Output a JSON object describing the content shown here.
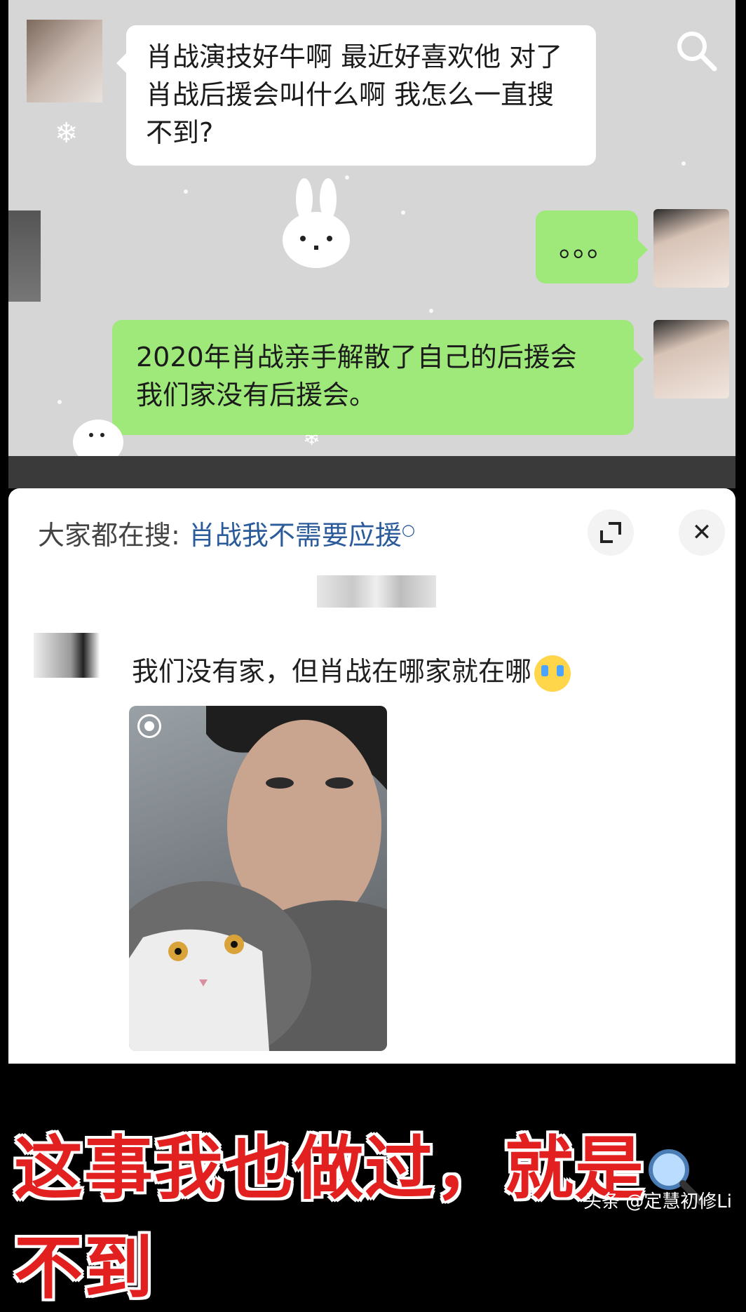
{
  "chat": {
    "received_message": "肖战演技好牛啊 最近好喜欢他 对了肖战后援会叫什么啊 我怎么一直搜不到?",
    "typing_dots": "。。。",
    "sent_message": "2020年肖战亲手解散了自己的后援会 我们家没有后援会。"
  },
  "comments_sheet": {
    "hot_search_label": "大家都在搜:",
    "hot_search_term": "肖战我不需要应援",
    "expand_icon": "expand-icon",
    "close_label": "✕",
    "comment_text": "我们没有家，但肖战在哪家就在哪",
    "comment_emoji": "crying-emoji"
  },
  "caption": {
    "part1": "这事我也做过，就是",
    "part2": "不到",
    "color": "#e32020"
  },
  "watermark": "头条 @定慧初修Li",
  "colors": {
    "green_bubble": "#9fe87a",
    "link_blue": "#2b5b9a"
  }
}
